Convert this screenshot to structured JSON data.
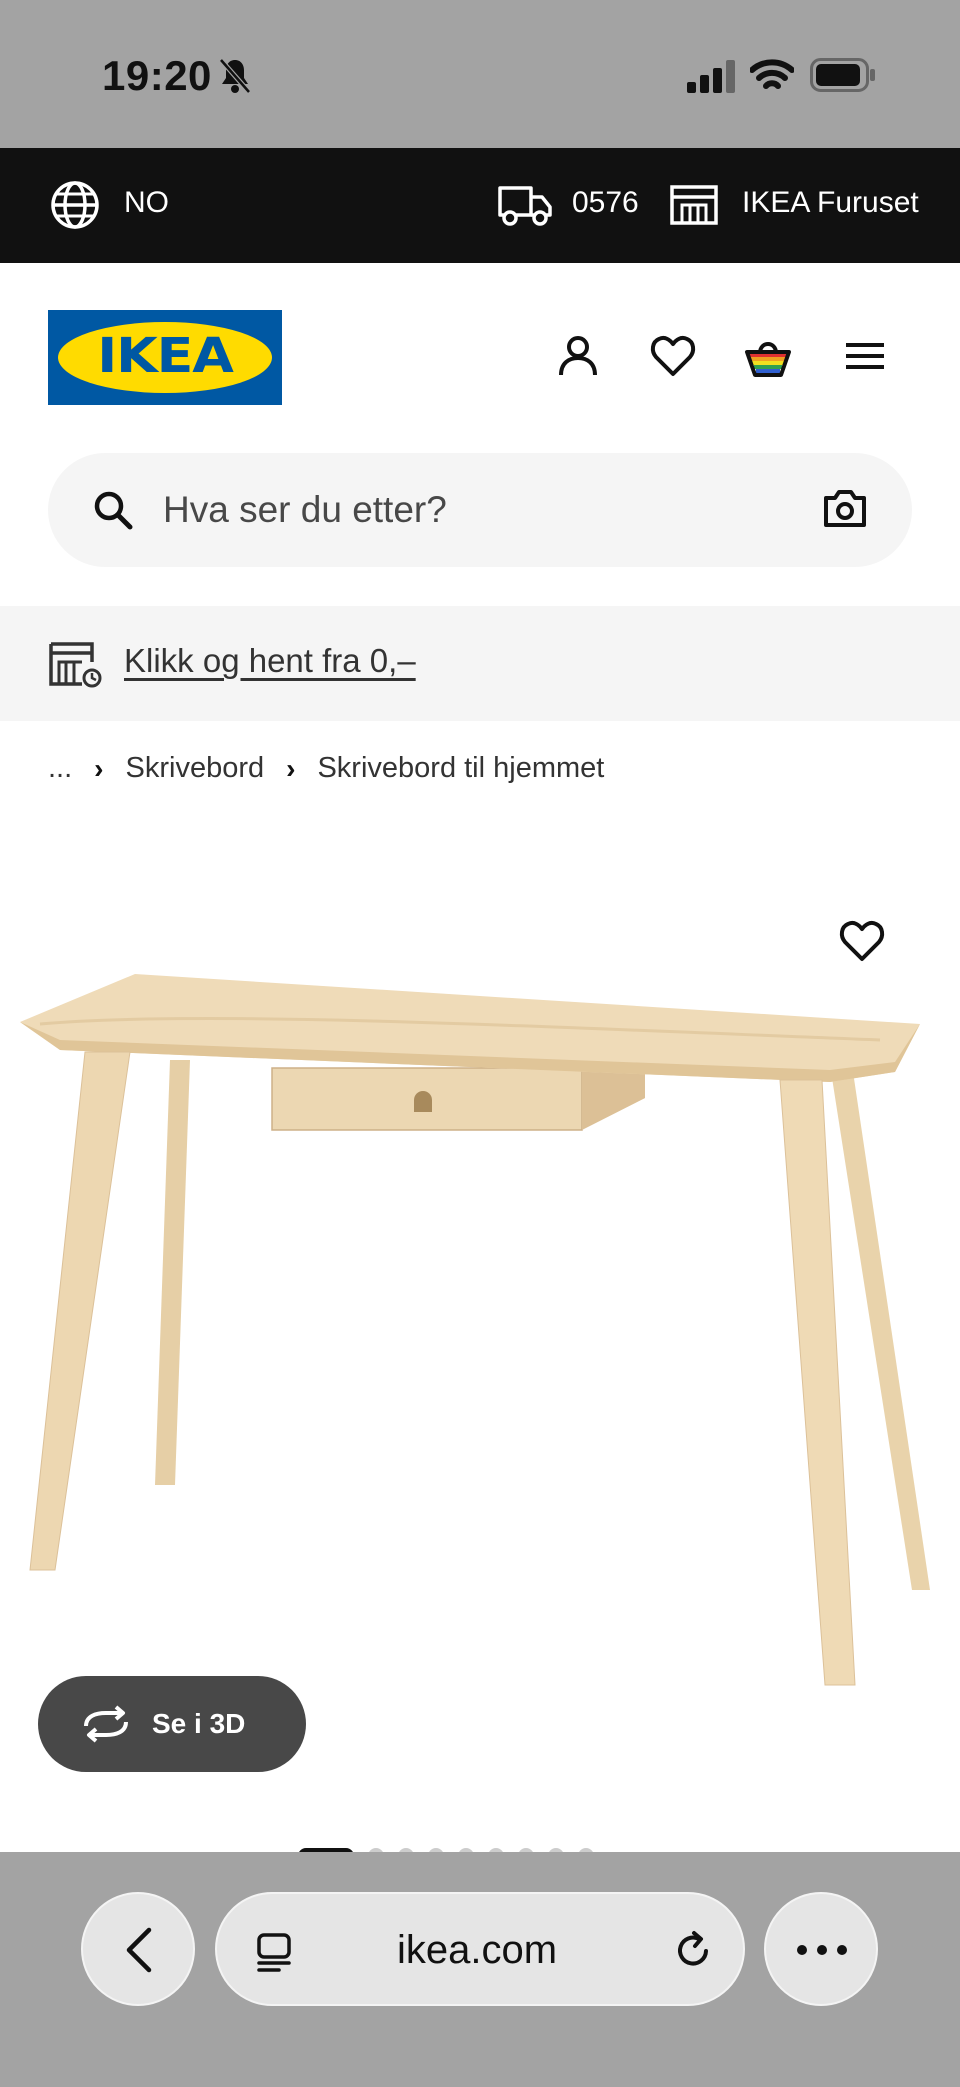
{
  "status_bar": {
    "time": "19:20"
  },
  "top_bar": {
    "country": "NO",
    "postcode": "0576",
    "store": "IKEA Furuset"
  },
  "header": {
    "logo_text": "IKEA",
    "search_placeholder": "Hva ser du etter?"
  },
  "promo": {
    "link_text": "Klikk og hent fra 0,–"
  },
  "breadcrumbs": [
    "...",
    "Skrivebord",
    "Skrivebord til hjemmet"
  ],
  "product_image": {
    "button_3d": "Se i 3D",
    "image_count": 10,
    "active_index": 0
  },
  "browser": {
    "url": "ikea.com"
  },
  "colors": {
    "ikea_blue": "#0058a3",
    "ikea_yellow": "#ffdb00"
  }
}
